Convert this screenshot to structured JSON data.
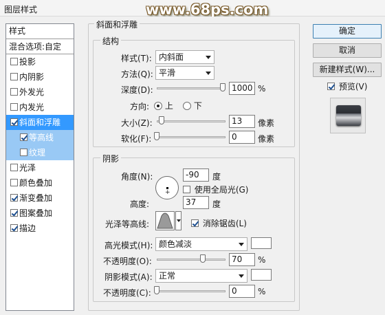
{
  "window": {
    "title": "图层样式"
  },
  "watermark": "www.68ps.com",
  "sidebar": {
    "header": "样式",
    "blend_options": "混合选项:自定",
    "items": [
      {
        "label": "投影",
        "checked": false
      },
      {
        "label": "内阴影",
        "checked": false
      },
      {
        "label": "外发光",
        "checked": false
      },
      {
        "label": "内发光",
        "checked": false
      },
      {
        "label": "斜面和浮雕",
        "checked": true
      },
      {
        "label": "等高线",
        "checked": true
      },
      {
        "label": "纹理",
        "checked": false
      },
      {
        "label": "光泽",
        "checked": false
      },
      {
        "label": "颜色叠加",
        "checked": false
      },
      {
        "label": "渐变叠加",
        "checked": true
      },
      {
        "label": "图案叠加",
        "checked": true
      },
      {
        "label": "描边",
        "checked": true
      }
    ]
  },
  "bevel": {
    "group_title": "斜面和浮雕",
    "structure_title": "结构",
    "style_label": "样式(T):",
    "style_value": "内斜面",
    "technique_label": "方法(Q):",
    "technique_value": "平滑",
    "depth_label": "深度(D):",
    "depth_value": "1000",
    "depth_unit": "%",
    "direction_label": "方向:",
    "direction_up": "上",
    "direction_down": "下",
    "direction_selected": "up",
    "size_label": "大小(Z):",
    "size_value": "13",
    "size_unit": "像素",
    "soften_label": "软化(F):",
    "soften_value": "0",
    "soften_unit": "像素"
  },
  "shading": {
    "group_title": "阴影",
    "angle_label": "角度(N):",
    "angle_value": "-90",
    "angle_unit": "度",
    "global_light_label": "使用全局光(G)",
    "global_light_checked": false,
    "altitude_label": "高度:",
    "altitude_value": "37",
    "altitude_unit": "度",
    "gloss_contour_label": "光泽等高线:",
    "anti_alias_label": "消除锯齿(L)",
    "anti_alias_checked": true,
    "highlight_mode_label": "高光模式(H):",
    "highlight_mode_value": "颜色减淡",
    "highlight_color": "#ffffff",
    "highlight_opacity_label": "不透明度(O):",
    "highlight_opacity_value": "70",
    "highlight_opacity_unit": "%",
    "shadow_mode_label": "阴影模式(A):",
    "shadow_mode_value": "正常",
    "shadow_color": "#ffffff",
    "shadow_opacity_label": "不透明度(C):",
    "shadow_opacity_value": "0",
    "shadow_opacity_unit": "%"
  },
  "actions": {
    "ok": "确定",
    "cancel": "取消",
    "new_style": "新建样式(W)...",
    "preview_label": "预览(V)",
    "preview_checked": true
  }
}
